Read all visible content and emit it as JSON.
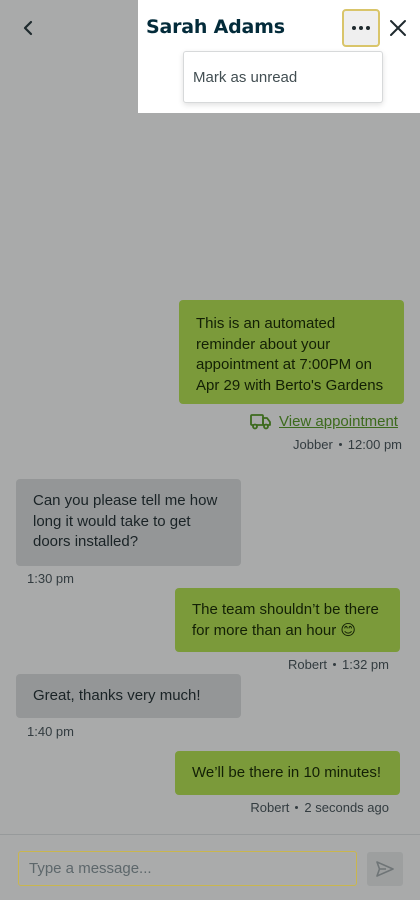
{
  "header": {
    "title": "Sarah Adams",
    "menu": {
      "items": [
        {
          "label": "Mark as unread"
        }
      ]
    }
  },
  "messages": [
    {
      "direction": "outgoing",
      "text": "This is an automated reminder about your appointment at 7:00PM on Apr 29 with Berto's Gardens",
      "link_label": "View appointment",
      "sender": "Jobber",
      "time": "12:00 pm"
    },
    {
      "direction": "incoming",
      "text": "Can you please tell me how long it would take to get doors installed?",
      "time": "1:30 pm"
    },
    {
      "direction": "outgoing",
      "text": "The team shouldn’t be there for more than an hour 😊",
      "sender": "Robert",
      "time": "1:32 pm"
    },
    {
      "direction": "incoming",
      "text": "Great, thanks very much!",
      "time": "1:40 pm"
    },
    {
      "direction": "outgoing",
      "text": "We’ll be there in 10 minutes!",
      "sender": "Robert",
      "time": "2 seconds ago"
    }
  ],
  "composer": {
    "placeholder": "Type a message...",
    "value": ""
  },
  "colors": {
    "outgoing_bubble": "#7b9a3a",
    "incoming_bubble": "#949697",
    "title": "#032b3a",
    "link": "#3c6a1d"
  },
  "icons": [
    "chevron-left-icon",
    "more-icon",
    "close-icon",
    "truck-icon",
    "send-icon"
  ]
}
